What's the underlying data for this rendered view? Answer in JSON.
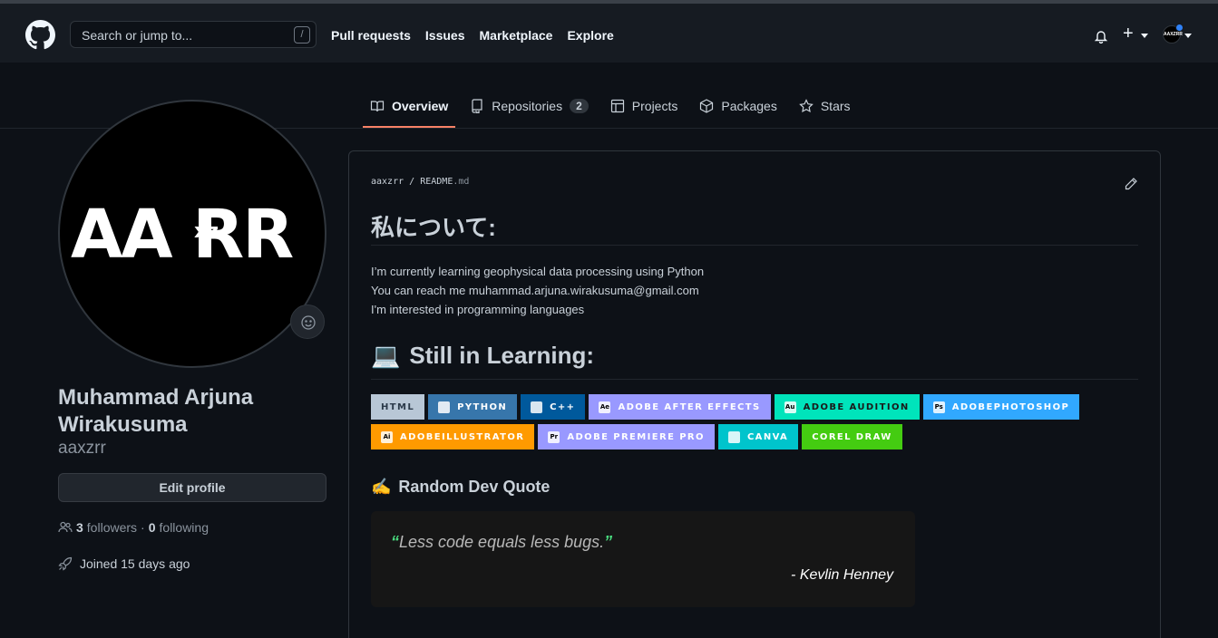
{
  "header": {
    "search_placeholder": "Search or jump to...",
    "search_shortcut": "/",
    "nav": [
      "Pull requests",
      "Issues",
      "Marketplace",
      "Explore"
    ],
    "avatar_text": "AAXZRR"
  },
  "tabs": [
    {
      "label": "Overview",
      "icon": "book-icon",
      "active": true
    },
    {
      "label": "Repositories",
      "icon": "repo-icon",
      "count": "2"
    },
    {
      "label": "Projects",
      "icon": "table-icon"
    },
    {
      "label": "Packages",
      "icon": "package-icon"
    },
    {
      "label": "Stars",
      "icon": "star-icon"
    }
  ],
  "profile": {
    "avatar_text": "AA RR",
    "avatar_small": "xz",
    "name": "Muhammad Arjuna Wirakusuma",
    "login": "aaxzrr",
    "edit_label": "Edit profile",
    "followers_count": "3",
    "followers_label": "followers",
    "following_count": "0",
    "following_label": "following",
    "separator": "·",
    "joined": "Joined 15 days ago"
  },
  "readme": {
    "owner": "aaxzrr",
    "sep": "/",
    "file": "README",
    "ext": ".md",
    "heading": "私について:",
    "lines": [
      "I’m currently learning geophysical data processing using Python",
      "You can reach me muhammad.arjuna.wirakusuma@gmail.com",
      "I'm interested in programming languages"
    ],
    "learning_emoji": "💻",
    "learning_heading": "Still in Learning:",
    "badges": [
      {
        "label": "HTML",
        "bg": "#b8c7d6",
        "fg": "#2b3a4a",
        "icon": ""
      },
      {
        "label": "PYTHON",
        "bg": "#3776ab",
        "fg": "#ffffff",
        "icon": "python-icon"
      },
      {
        "label": "C++",
        "bg": "#00599c",
        "fg": "#ffffff",
        "icon": "cpp-icon"
      },
      {
        "label": "ADOBE AFTER EFFECTS",
        "bg": "#9999ff",
        "fg": "#ffffff",
        "icon": "Ae"
      },
      {
        "label": "ADOBE AUDITION",
        "bg": "#00e4bb",
        "fg": "#1a1a1a",
        "icon": "Au"
      },
      {
        "label": "ADOBEPHOTOSHOP",
        "bg": "#31a8ff",
        "fg": "#ffffff",
        "icon": "Ps"
      },
      {
        "label": "ADOBEILLUSTRATOR",
        "bg": "#ff9a00",
        "fg": "#ffffff",
        "icon": "Ai"
      },
      {
        "label": "ADOBE PREMIERE PRO",
        "bg": "#9999ff",
        "fg": "#ffffff",
        "icon": "Pr"
      },
      {
        "label": "CANVA",
        "bg": "#00c4cc",
        "fg": "#ffffff",
        "icon": "canva-icon"
      },
      {
        "label": "COREL DRAW",
        "bg": "#44cc11",
        "fg": "#ffffff",
        "icon": ""
      }
    ],
    "quote_emoji": "✍️",
    "quote_heading": "Random Dev Quote",
    "quote_open": "“",
    "quote_text": "Less code equals less bugs.",
    "quote_close": "”",
    "quote_author": "- Kevlin Henney"
  }
}
